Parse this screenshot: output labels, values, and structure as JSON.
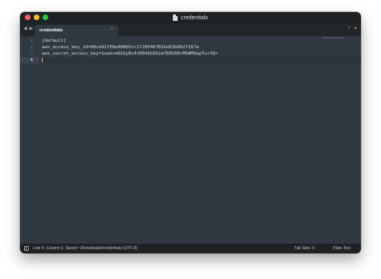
{
  "window": {
    "title": "credentials"
  },
  "tab": {
    "label": "credentials",
    "close_glyph": "×"
  },
  "toolbar": {
    "back_glyph": "◀",
    "forward_glyph": "▶",
    "add_glyph": "+",
    "menu_glyph": "▾"
  },
  "editor": {
    "lines": [
      {
        "number": "1",
        "text": "[default]"
      },
      {
        "number": "2",
        "text": "aws_access_key_id=68ce92f58a480b5cc17205467816a53b662f167a"
      },
      {
        "number": "3",
        "text": "aws_secret_access_key=1swn+e6GIyRz4tE042b95im7E8V08rM5WM9apTs+fQ="
      },
      {
        "number": "4",
        "text": ""
      }
    ],
    "current_line": 4
  },
  "statusbar": {
    "position_text": "Line 4, Column 1; Saved ~/Downloads/credentials (UTF-8)",
    "tab_size": "Tab Size: 4",
    "syntax": "Plain Text"
  },
  "colors": {
    "background": "#303841",
    "chrome": "#1f2225",
    "caret": "#f9ae58",
    "text": "#d8dee9"
  },
  "icons": [
    "file-icon",
    "panel-toggle-icon"
  ]
}
